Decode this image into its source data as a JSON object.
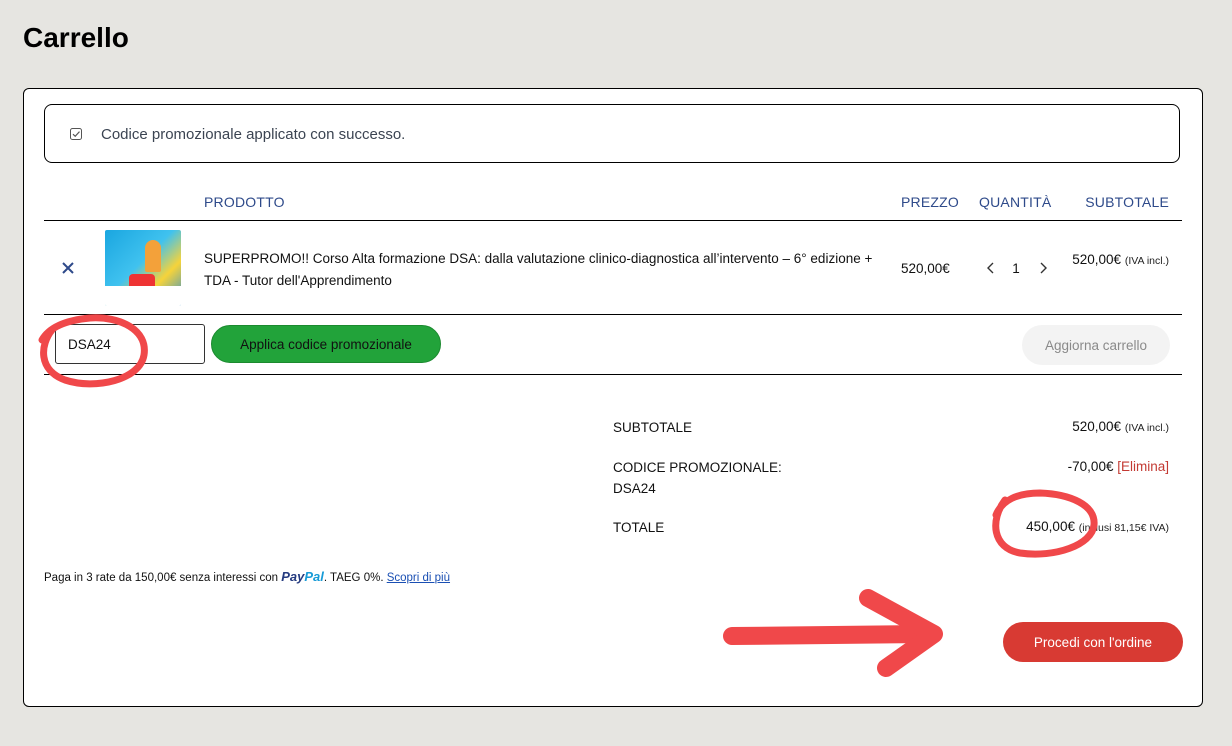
{
  "page": {
    "title": "Carrello"
  },
  "notice": {
    "text": "Codice promozionale applicato con successo.",
    "icon": "check-square-icon"
  },
  "table": {
    "headers": {
      "product": "PRODOTTO",
      "price": "PREZZO",
      "quantity": "QUANTITÀ",
      "subtotal": "SUBTOTALE"
    },
    "rows": [
      {
        "name": "SUPERPROMO!! Corso Alta formazione DSA: dalla valutazione clinico-diagnostica all’intervento – 6° edizione + TDA - Tutor dell'Apprendimento",
        "price": "520,00€",
        "quantity": "1",
        "subtotal": "520,00€",
        "subtotal_note": "(IVA incl.)"
      }
    ]
  },
  "coupon": {
    "value": "DSA24",
    "apply_label": "Applica codice promozionale",
    "update_label": "Aggiorna carrello"
  },
  "totals": {
    "subtotal_label": "SUBTOTALE",
    "subtotal_value": "520,00€",
    "subtotal_note": "(IVA incl.)",
    "promo_label": "CODICE PROMOZIONALE:",
    "promo_code": "DSA24",
    "promo_value": "-70,00€",
    "promo_remove": "[Elimina]",
    "total_label": "TOTALE",
    "total_value": "450,00€",
    "total_note": "(inclusi 81,15€ IVA)"
  },
  "paypal": {
    "text": "Paga in 3 rate da 150,00€ senza interessi con",
    "logo_part1": "Pay",
    "logo_part2": "Pal",
    "taeg": ". TAEG 0%.",
    "link": "Scopri di più"
  },
  "checkout": {
    "label": "Procedi con l'ordine"
  },
  "colors": {
    "accent_green": "#22a33a",
    "accent_red": "#d83a33",
    "header_blue": "#2e4a8a",
    "annotation_red": "#f0484a"
  }
}
